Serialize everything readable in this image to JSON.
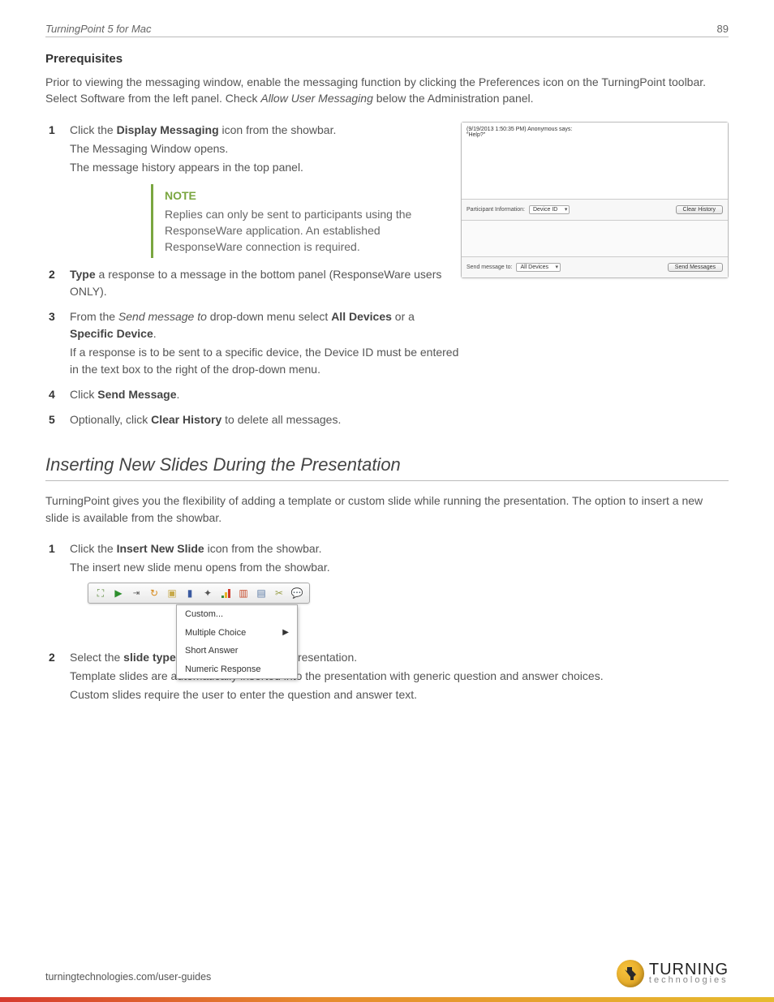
{
  "header": {
    "title": "TurningPoint 5 for Mac",
    "page": "89"
  },
  "prereq": {
    "heading": "Prerequisites",
    "intro_a": "Prior to viewing the messaging window, enable the messaging function by clicking the Preferences icon on the TurningPoint toolbar. Select Software from the left panel. Check ",
    "intro_em": "Allow User Messaging",
    "intro_b": " below the Administration panel."
  },
  "steps1": {
    "s1_a": "Click the ",
    "s1_b": "Display Messaging",
    "s1_c": " icon from the showbar.",
    "s1_sub1": "The Messaging Window opens.",
    "s1_sub2": "The message history appears in the top panel.",
    "note_title": "NOTE",
    "note_body": "Replies can only be sent to participants using the ResponseWare application. An established ResponseWare connection is required.",
    "s2_a": "Type",
    "s2_b": " a response to a message in the bottom panel (ResponseWare users ONLY).",
    "s3_a": "From the ",
    "s3_em": "Send message to",
    "s3_b": " drop-down menu select ",
    "s3_bold1": "All Devices",
    "s3_c": " or a ",
    "s3_bold2": "Specific Device",
    "s3_d": ".",
    "s3_sub": "If a response is to be sent to a specific device, the Device ID must be entered in the text box to the right of the drop-down menu.",
    "s4_a": "Click ",
    "s4_b": "Send Message",
    "s4_c": ".",
    "s5_a": "Optionally, click ",
    "s5_b": "Clear History",
    "s5_c": " to delete all messages."
  },
  "msg_window": {
    "history": "(9/19/2013 1:50:35 PM) Anonymous says:",
    "history2": "\"Help?\"",
    "pi_label": "Participant Information:",
    "pi_select": "Device ID",
    "clear_btn": "Clear History",
    "send_label": "Send message to:",
    "send_select": "All Devices",
    "send_btn": "Send Messages"
  },
  "section2": {
    "title": "Inserting New Slides During the Presentation",
    "intro": "TurningPoint gives you the flexibility of adding a template or custom slide while running the presentation. The option to insert a new slide is available from the showbar.",
    "s1_a": "Click the ",
    "s1_b": "Insert New Slide",
    "s1_c": " icon from the showbar.",
    "s1_sub": "The insert new slide menu opens from the showbar.",
    "menu": {
      "i1": "Custom...",
      "i2": "Multiple Choice",
      "i3": "Short Answer",
      "i4": "Numeric Response"
    },
    "s2_a": "Select the ",
    "s2_b": "slide type",
    "s2_c": " to be inserted into the presentation.",
    "s2_sub1": "Template slides are automatically inserted into the presentation with generic question and answer choices.",
    "s2_sub2": "Custom slides require the user to enter the question and answer text."
  },
  "footer": {
    "url": "turningtechnologies.com/user-guides"
  },
  "logo": {
    "line1": "TURNING",
    "line2": "technologies"
  }
}
